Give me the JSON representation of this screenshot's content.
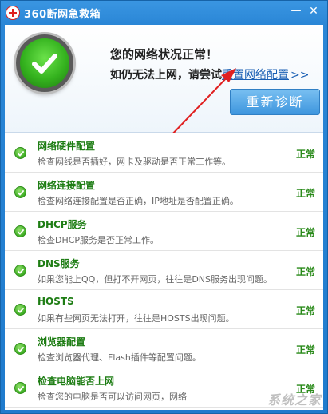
{
  "window": {
    "title": "360断网急救箱",
    "min_glyph": "—",
    "close_glyph": "✕"
  },
  "header": {
    "status_title": "您的网络状况正常！",
    "hint_prefix": "如仍无法上网，请尝试",
    "reset_link": "重置网络配置",
    "reset_arrows": ">>",
    "rediagnose_label": "重新诊断",
    "status_color": "#3fb51f",
    "annotation_arrow_color": "#e02020"
  },
  "items": [
    {
      "title": "网络硬件配置",
      "desc": "检查网线是否插好，网卡及驱动是否正常工作等。",
      "status": "正常"
    },
    {
      "title": "网络连接配置",
      "desc": "检查网络连接配置是否正确，IP地址是否配置正确。",
      "status": "正常"
    },
    {
      "title": "DHCP服务",
      "desc": "检查DHCP服务是否正常工作。",
      "status": "正常"
    },
    {
      "title": "DNS服务",
      "desc": "如果您能上QQ，但打不开网页，往往是DNS服务出现问题。",
      "status": "正常"
    },
    {
      "title": "HOSTS",
      "desc": "如果有些网页无法打开，往往是HOSTS出现问题。",
      "status": "正常"
    },
    {
      "title": "浏览器配置",
      "desc": "检查浏览器代理、Flash插件等配置问题。",
      "status": "正常"
    },
    {
      "title": "检查电脑能否上网",
      "desc": "检查您的电脑是否可以访问网页，网络",
      "status": "正常"
    }
  ],
  "watermark": "系统之家"
}
